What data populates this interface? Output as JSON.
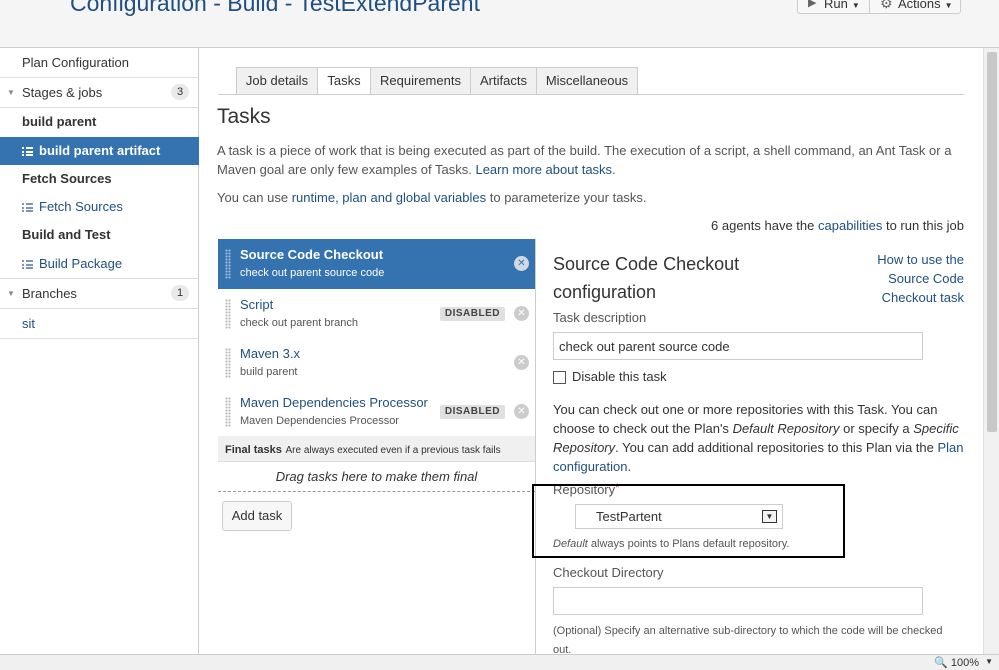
{
  "header": {
    "title": "Configuration - Build - TestExtendParent",
    "run_label": "Run",
    "actions_label": "Actions"
  },
  "sidebar": {
    "plan_configuration": "Plan Configuration",
    "stages_jobs": "Stages & jobs",
    "stages_count": "3",
    "stage1": "build parent",
    "job1": "build parent artifact",
    "stage2": "Fetch Sources",
    "job2": "Fetch Sources",
    "stage3": "Build and Test",
    "job3": "Build Package",
    "branches": "Branches",
    "branches_count": "1",
    "branch1": "sit"
  },
  "tabs": [
    "Job details",
    "Tasks",
    "Requirements",
    "Artifacts",
    "Miscellaneous"
  ],
  "main": {
    "heading": "Tasks",
    "intro": "A task is a piece of work that is being executed as part of the build. The execution of a script, a shell command, an Ant Task or a Maven goal are only few examples of Tasks.",
    "learn_more": "Learn more about tasks",
    "vars_prefix": "You can use",
    "vars_link": "runtime, plan and global variables",
    "vars_suffix": "to parameterize your tasks.",
    "agents_prefix": "6 agents have the",
    "agents_link": "capabilities",
    "agents_suffix": "to run this job"
  },
  "tasks": [
    {
      "name": "Source Code Checkout",
      "desc": "check out parent source code",
      "disabled": false
    },
    {
      "name": "Script",
      "desc": "check out parent branch",
      "disabled": true
    },
    {
      "name": "Maven 3.x",
      "desc": "build parent",
      "disabled": false
    },
    {
      "name": "Maven Dependencies Processor",
      "desc": "Maven Dependencies Processor",
      "disabled": true
    }
  ],
  "disabled_badge": "DISABLED",
  "final_tasks": {
    "title": "Final tasks",
    "note": "Are always executed even if a previous task fails",
    "drop_hint": "Drag tasks here to make them final"
  },
  "add_task": "Add task",
  "config": {
    "title": "Source Code Checkout configuration",
    "help_link": "How to use the Source Code Checkout task",
    "task_desc_label": "Task description",
    "task_desc_value": "check out parent source code",
    "disable_label": "Disable this task",
    "repo_info_1": "You can check out one or more repositories with this Task. You can choose to check out the Plan's",
    "repo_info_default": "Default Repository",
    "repo_info_2": "or specify a",
    "repo_info_specific": "Specific Repository",
    "repo_info_3": ". You can add additional repositories to this Plan via the",
    "repo_info_link": "Plan configuration",
    "repo_info_4": ".",
    "repository_label": "Repository",
    "repository_required": "*",
    "repository_value": "TestPartent",
    "repo_note_em": "Default",
    "repo_note": "always points to Plans default repository.",
    "checkout_dir_label": "Checkout Directory",
    "checkout_dir_value": "",
    "optional_note": "(Optional) Specify an alternative sub-directory to which the code will be checked out."
  },
  "status": {
    "zoom": "100%"
  },
  "colors": {
    "accent": "#3572b0",
    "link": "#205081"
  }
}
